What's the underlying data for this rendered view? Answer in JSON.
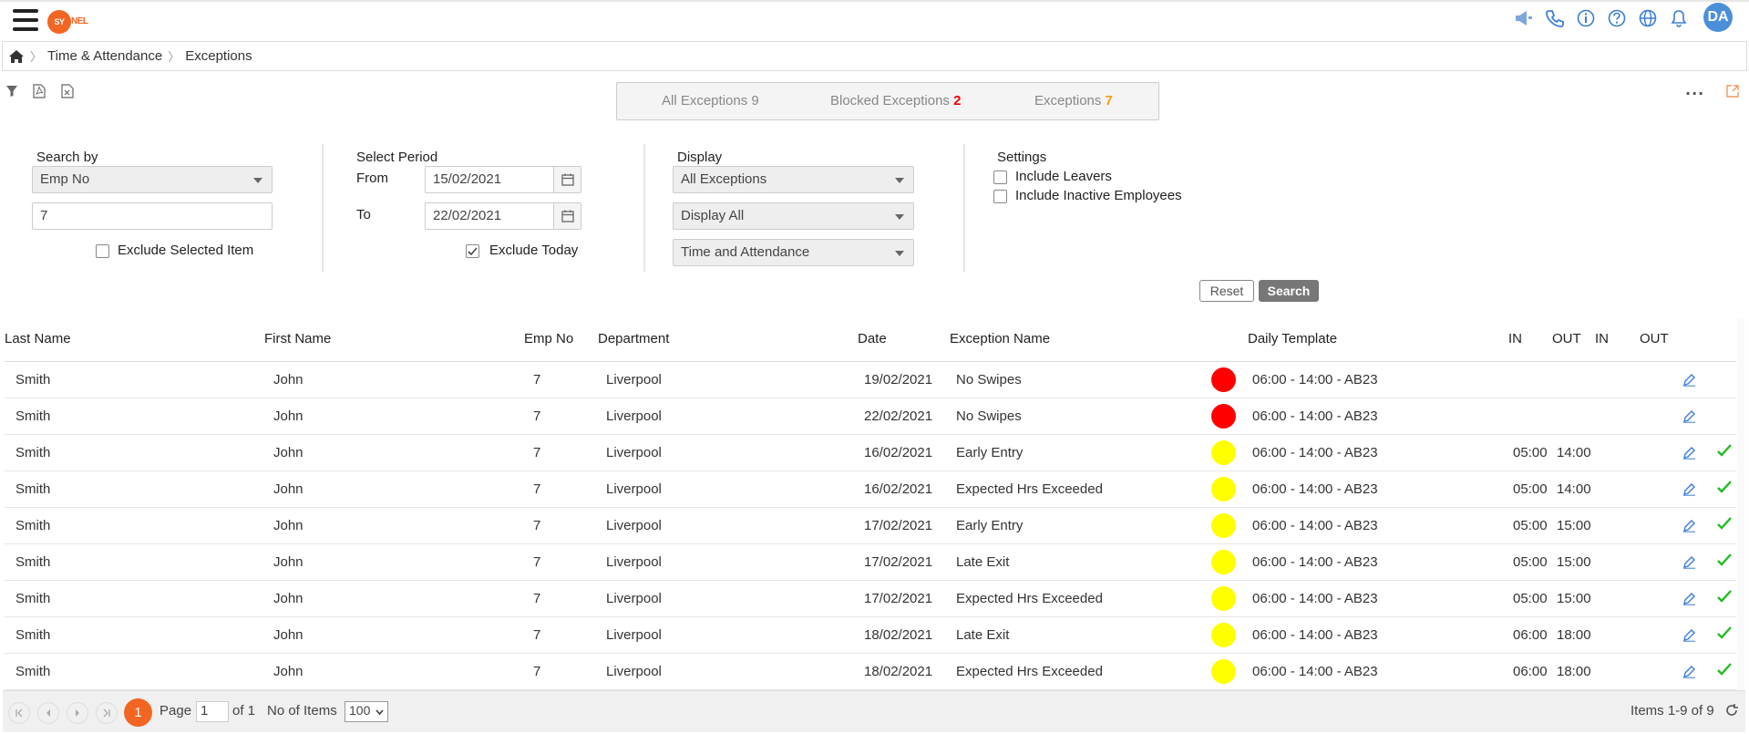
{
  "header": {
    "logo_left": "SY",
    "logo_right": "NEL",
    "avatar_initials": "DA",
    "icons": [
      "megaphone-icon",
      "phone-icon",
      "info-icon",
      "help-icon",
      "globe-icon",
      "bell-icon"
    ]
  },
  "breadcrumb": {
    "items": [
      "Time & Attendance",
      "Exceptions"
    ]
  },
  "tabs": [
    {
      "label": "All Exceptions",
      "count": "9"
    },
    {
      "label": "Blocked Exceptions",
      "count": "2"
    },
    {
      "label": "Exceptions",
      "count": "7"
    }
  ],
  "more_label": "···",
  "filters": {
    "search_by": {
      "label": "Search by",
      "selected": "Emp No",
      "value": "7",
      "exclude_label": "Exclude Selected Item",
      "exclude_checked": false
    },
    "period": {
      "label": "Select Period",
      "from_label": "From",
      "from": "15/02/2021",
      "to_label": "To",
      "to": "22/02/2021",
      "exclude_today_label": "Exclude Today",
      "exclude_today_checked": true
    },
    "display": {
      "label": "Display",
      "options": [
        "All Exceptions",
        "Display All",
        "Time and Attendance"
      ]
    },
    "settings": {
      "label": "Settings",
      "include_leavers": "Include Leavers",
      "include_inactive": "Include Inactive Employees"
    },
    "reset_label": "Reset",
    "search_label": "Search"
  },
  "table": {
    "columns": [
      "Last Name",
      "First Name",
      "Emp No",
      "Department",
      "Date",
      "Exception Name",
      "Daily Template",
      "IN",
      "OUT",
      "IN",
      "OUT"
    ],
    "rows": [
      {
        "last": "Smith",
        "first": "John",
        "emp": "7",
        "dept": "Liverpool",
        "date": "19/02/2021",
        "exception": "No Swipes",
        "status_color": "#ff0000",
        "template": "06:00 - 14:00 - AB23",
        "in1": "",
        "out1": "",
        "approved": false
      },
      {
        "last": "Smith",
        "first": "John",
        "emp": "7",
        "dept": "Liverpool",
        "date": "22/02/2021",
        "exception": "No Swipes",
        "status_color": "#ff0000",
        "template": "06:00 - 14:00 - AB23",
        "in1": "",
        "out1": "",
        "approved": false
      },
      {
        "last": "Smith",
        "first": "John",
        "emp": "7",
        "dept": "Liverpool",
        "date": "16/02/2021",
        "exception": "Early Entry",
        "status_color": "#ffff00",
        "template": "06:00 - 14:00 - AB23",
        "in1": "05:00",
        "out1": "14:00",
        "approved": true
      },
      {
        "last": "Smith",
        "first": "John",
        "emp": "7",
        "dept": "Liverpool",
        "date": "16/02/2021",
        "exception": "Expected Hrs Exceeded",
        "status_color": "#ffff00",
        "template": "06:00 - 14:00 - AB23",
        "in1": "05:00",
        "out1": "14:00",
        "approved": true
      },
      {
        "last": "Smith",
        "first": "John",
        "emp": "7",
        "dept": "Liverpool",
        "date": "17/02/2021",
        "exception": "Early Entry",
        "status_color": "#ffff00",
        "template": "06:00 - 14:00 - AB23",
        "in1": "05:00",
        "out1": "15:00",
        "approved": true
      },
      {
        "last": "Smith",
        "first": "John",
        "emp": "7",
        "dept": "Liverpool",
        "date": "17/02/2021",
        "exception": "Late Exit",
        "status_color": "#ffff00",
        "template": "06:00 - 14:00 - AB23",
        "in1": "05:00",
        "out1": "15:00",
        "approved": true
      },
      {
        "last": "Smith",
        "first": "John",
        "emp": "7",
        "dept": "Liverpool",
        "date": "17/02/2021",
        "exception": "Expected Hrs Exceeded",
        "status_color": "#ffff00",
        "template": "06:00 - 14:00 - AB23",
        "in1": "05:00",
        "out1": "15:00",
        "approved": true
      },
      {
        "last": "Smith",
        "first": "John",
        "emp": "7",
        "dept": "Liverpool",
        "date": "18/02/2021",
        "exception": "Late Exit",
        "status_color": "#ffff00",
        "template": "06:00 - 14:00 - AB23",
        "in1": "06:00",
        "out1": "18:00",
        "approved": true
      },
      {
        "last": "Smith",
        "first": "John",
        "emp": "7",
        "dept": "Liverpool",
        "date": "18/02/2021",
        "exception": "Expected Hrs Exceeded",
        "status_color": "#ffff00",
        "template": "06:00 - 14:00 - AB23",
        "in1": "06:00",
        "out1": "18:00",
        "approved": true
      }
    ]
  },
  "pager": {
    "current": "1",
    "page_label": "Page",
    "page_value": "1",
    "of_label": "of 1",
    "items_label": "No of Items",
    "items_per_page": "100",
    "summary": "Items 1-9 of 9"
  },
  "colors": {
    "accent": "#f26522",
    "blocked": "#ff0000",
    "warning": "#ffff00",
    "approve": "#22bb22",
    "edit": "#3b7dd8"
  }
}
